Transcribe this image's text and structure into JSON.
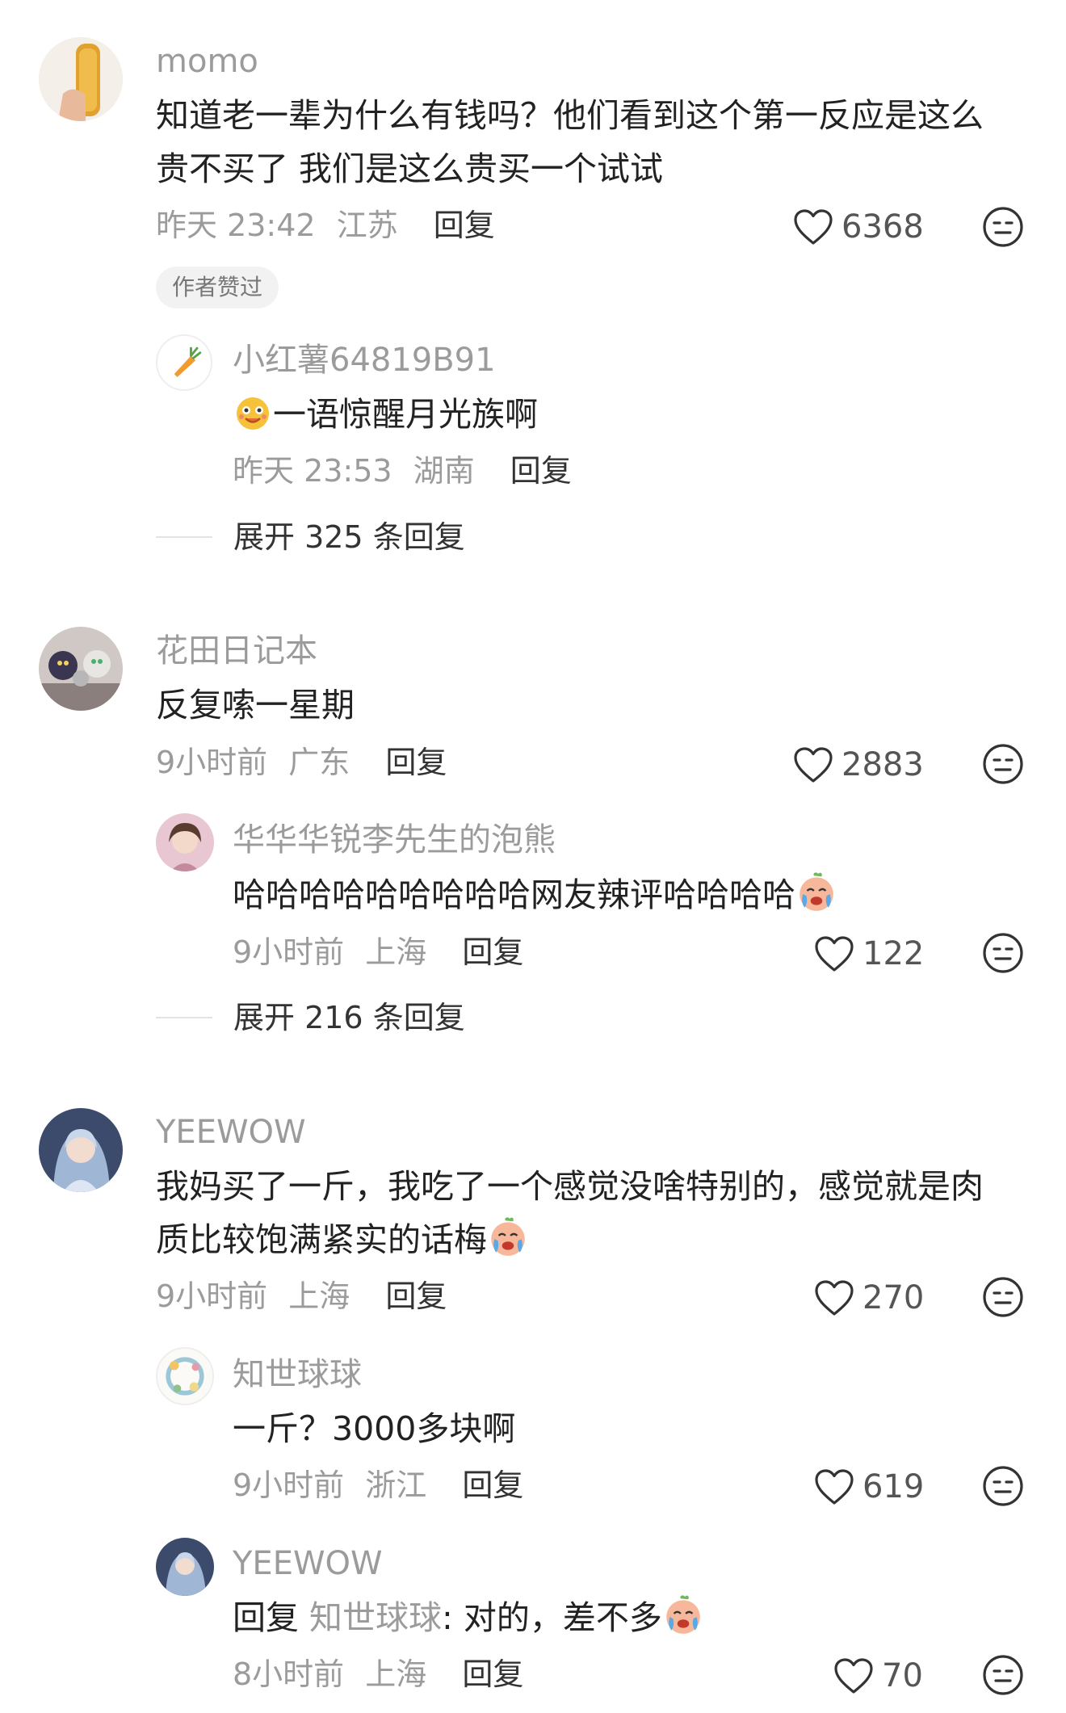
{
  "comments": [
    {
      "user": "momo",
      "text": "知道老一辈为什么有钱吗？他们看到这个第一反应是这么贵不买了 我们是这么贵买一个试试",
      "time": "昨天 23:42",
      "location": "江苏",
      "reply_label": "回复",
      "likes": "6368",
      "badge": "作者赞过",
      "replies": [
        {
          "user": "小红薯64819B91",
          "text": "一语惊醒月光族啊",
          "emoji_before": "smiling-face-emoji",
          "time": "昨天 23:53",
          "location": "湖南",
          "reply_label": "回复"
        }
      ],
      "expand_label": "展开 325 条回复"
    },
    {
      "user": "花田日记本",
      "text": "反复嗦一星期",
      "time": "9小时前",
      "location": "广东",
      "reply_label": "回复",
      "likes": "2883",
      "replies": [
        {
          "user": "华华华锐李先生的泡熊",
          "text": "哈哈哈哈哈哈哈哈哈网友辣评哈哈哈哈",
          "emoji_after": "crying-face-emoji",
          "time": "9小时前",
          "location": "上海",
          "reply_label": "回复",
          "likes": "122"
        }
      ],
      "expand_label": "展开 216 条回复"
    },
    {
      "user": "YEEWOW",
      "text": "我妈买了一斤，我吃了一个感觉没啥特别的，感觉就是肉质比较饱满紧实的话梅",
      "emoji_after": "crying-face-emoji",
      "time": "9小时前",
      "location": "上海",
      "reply_label": "回复",
      "likes": "270",
      "replies": [
        {
          "user": "知世球球",
          "text": "一斤？3000多块啊",
          "time": "9小时前",
          "location": "浙江",
          "reply_label": "回复",
          "likes": "619"
        },
        {
          "user": "YEEWOW",
          "reply_prefix": "回复",
          "reply_target": "知世球球",
          "text": ": 对的，差不多",
          "emoji_after": "crying-face-emoji",
          "time": "8小时前",
          "location": "上海",
          "reply_label": "回复",
          "likes": "70"
        }
      ]
    }
  ],
  "colors": {
    "secondary_text": "#9b9b9b",
    "primary_text": "#222222",
    "badge_bg": "#f2f2f2"
  }
}
